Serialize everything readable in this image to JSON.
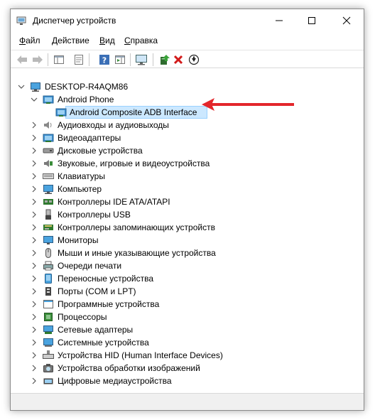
{
  "window": {
    "title": "Диспетчер устройств",
    "controls": {
      "minimize": "minimize-icon",
      "maximize": "maximize-icon",
      "close": "close-icon"
    }
  },
  "menu": [
    {
      "label": "Файл",
      "ul": "Ф",
      "rest": "айл"
    },
    {
      "label": "Действие",
      "ul": "Д",
      "rest": "ействие"
    },
    {
      "label": "Вид",
      "ul": "В",
      "rest": "ид"
    },
    {
      "label": "Справка",
      "ul": "С",
      "rest": "правка"
    }
  ],
  "toolbar": [
    "back-icon",
    "forward-icon",
    "properties-pane-icon",
    "properties-icon",
    "help-icon",
    "action-pane-icon",
    "monitor-scan-icon",
    "update-driver-icon",
    "uninstall-icon",
    "disable-download-icon"
  ],
  "colors": {
    "selection": "#cce8ff",
    "selection_border": "#99d1ff",
    "annotation": "#e3262b"
  },
  "tree": {
    "root": "DESKTOP-R4AQM86",
    "android_phone": "Android Phone",
    "adb": "Android Composite ADB Interface",
    "categories": [
      "Аудиовходы и аудиовыходы",
      "Видеоадаптеры",
      "Дисковые устройства",
      "Звуковые, игровые и видеоустройства",
      "Клавиатуры",
      "Компьютер",
      "Контроллеры IDE ATA/ATAPI",
      "Контроллеры USB",
      "Контроллеры запоминающих устройств",
      "Мониторы",
      "Мыши и иные указывающие устройства",
      "Очереди печати",
      "Переносные устройства",
      "Порты (COM и LPT)",
      "Программные устройства",
      "Процессоры",
      "Сетевые адаптеры",
      "Системные устройства",
      "Устройства HID (Human Interface Devices)",
      "Устройства обработки изображений",
      "Цифровые медиаустройства"
    ]
  }
}
